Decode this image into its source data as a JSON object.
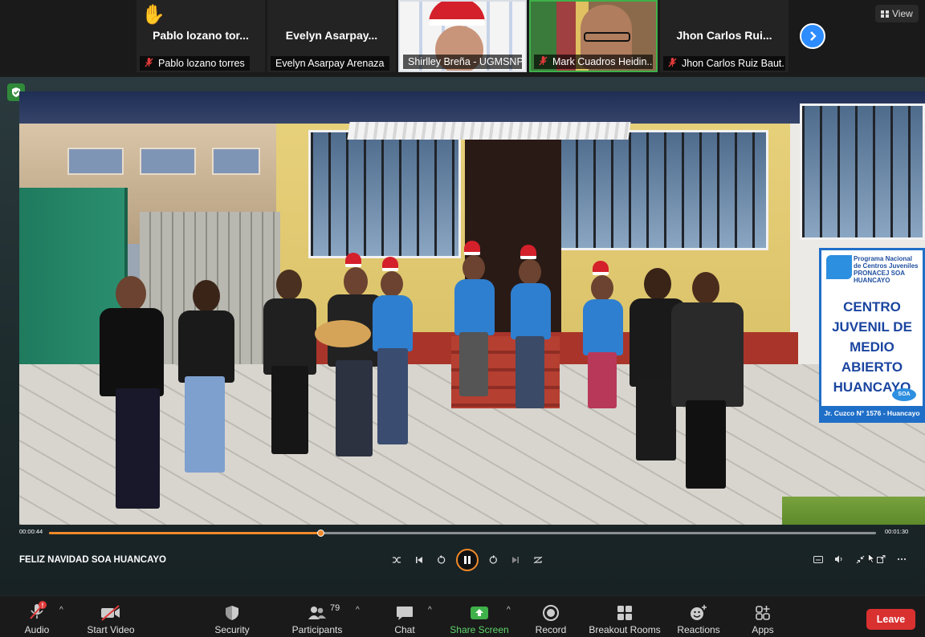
{
  "gallery": {
    "tiles": [
      {
        "big_name": "Pablo lozano tor...",
        "caption": "Pablo lozano torres",
        "muted": true,
        "raised_hand": true
      },
      {
        "big_name": "Evelyn  Asarpay...",
        "caption": "Evelyn Asarpay Arenaza",
        "muted": false
      },
      {
        "caption": "Shirlley Breña - UGMSNPL",
        "muted": false,
        "video": true
      },
      {
        "caption": "Mark Cuadros Heidin...",
        "muted": true,
        "video": true,
        "active": true
      },
      {
        "big_name": "Jhon Carlos Rui...",
        "caption": "Jhon Carlos Ruiz Baut...",
        "muted": true
      }
    ],
    "next_icon": "chevron-right-icon",
    "view_label": "View"
  },
  "share": {
    "sign": {
      "small_text": "Programa Nacional de Centros Juveniles PRONACEJ SOA HUANCAYO",
      "main_text": "CENTRO\nJUVENIL DE\nMEDIO ABIERTO\nHUANCAYO",
      "soa": "SOA",
      "footer": "Jr. Cuzco N° 1576 - Huancayo"
    },
    "player": {
      "elapsed": "00:00:44",
      "duration": "00:01:30",
      "progress_fraction": 0.328,
      "title": "FELIZ NAVIDAD SOA HUANCAYO"
    }
  },
  "toolbar": {
    "audio": "Audio",
    "start_video": "Start Video",
    "security": "Security",
    "participants": "Participants",
    "participants_count": "79",
    "chat": "Chat",
    "share_screen": "Share Screen",
    "record": "Record",
    "breakout_rooms": "Breakout Rooms",
    "reactions": "Reactions",
    "apps": "Apps",
    "leave": "Leave"
  },
  "colors": {
    "accent_blue": "#2d8cff",
    "share_green": "#5fd46b",
    "leave_red": "#d93030",
    "progress_orange": "#f08a2c"
  }
}
